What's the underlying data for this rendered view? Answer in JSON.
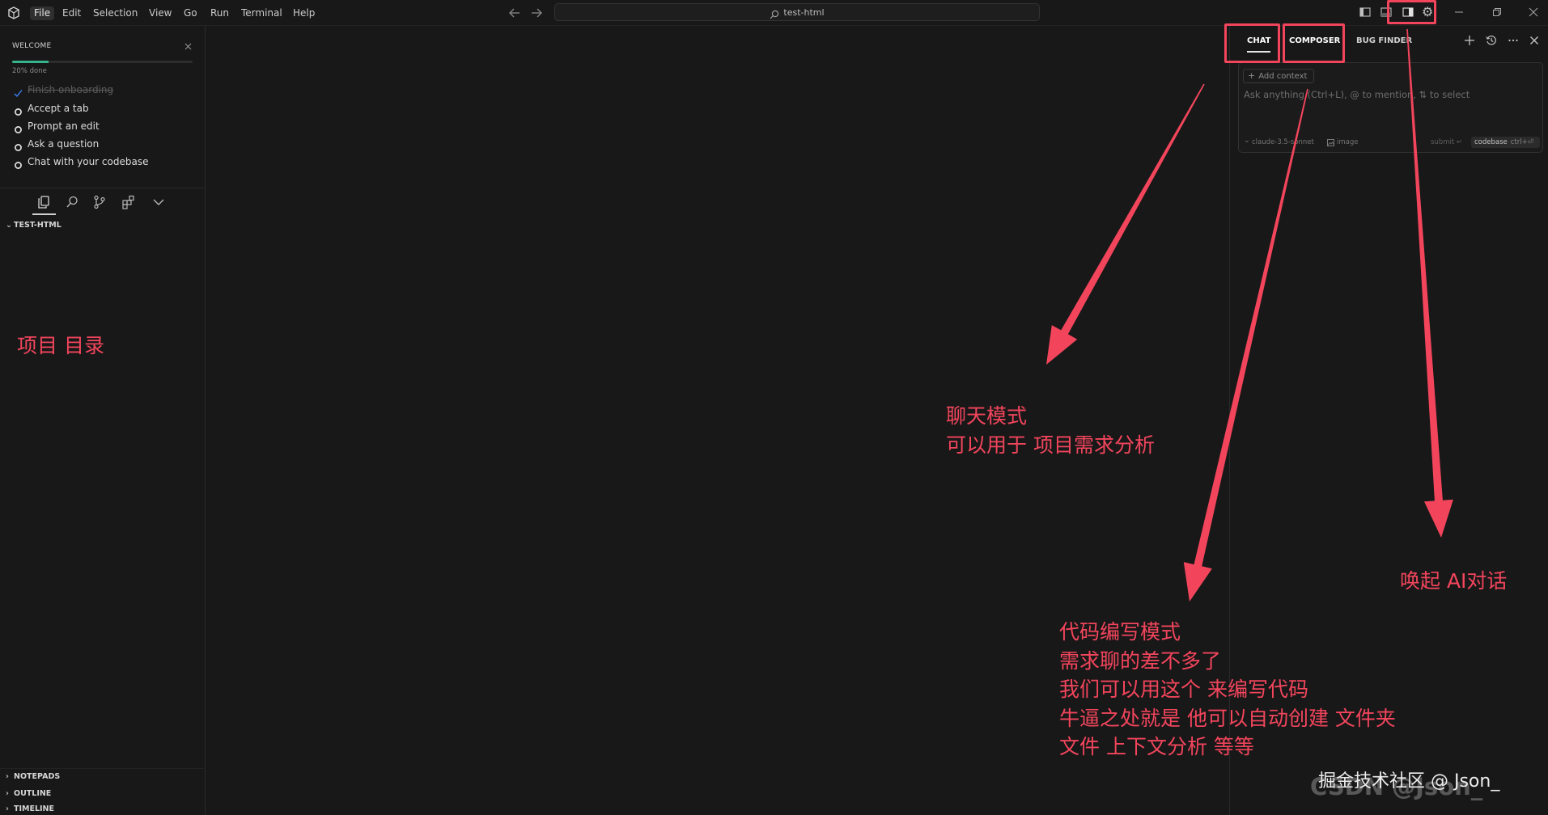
{
  "app": {
    "menu": [
      "File",
      "Edit",
      "Selection",
      "View",
      "Go",
      "Run",
      "Terminal",
      "Help"
    ],
    "search": "test-html"
  },
  "welcome": {
    "title": "WELCOME",
    "progress": 0.2,
    "progress_text": "20% done",
    "items": [
      {
        "label": "Finish onboarding",
        "done": true
      },
      {
        "label": "Accept a tab",
        "done": false
      },
      {
        "label": "Prompt an edit",
        "done": false
      },
      {
        "label": "Ask a question",
        "done": false
      },
      {
        "label": "Chat with your codebase",
        "done": false
      }
    ]
  },
  "explorer": {
    "folder": "TEST-HTML",
    "sections": [
      "NOTEPADS",
      "OUTLINE",
      "TIMELINE"
    ]
  },
  "chat_panel": {
    "tabs": [
      "CHAT",
      "COMPOSER",
      "BUG FINDER"
    ],
    "add_context": "Add context",
    "placeholder": "Ask anything (Ctrl+L), @ to mention, ⇅ to select",
    "model": "claude-3.5-sonnet",
    "image_label": "image",
    "submit_label": "submit ↵",
    "codebase_label": "codebase",
    "codebase_shortcut": "ctrl+⏎"
  },
  "annotations": {
    "project_dir": "项目 目录",
    "chat_mode": [
      "聊天模式",
      "可以用于 项目需求分析"
    ],
    "composer_mode": [
      "代码编写模式",
      "需求聊的差不多了",
      "我们可以用这个 来编写代码",
      "牛逼之处就是 他可以自动创建 文件夹",
      "文件 上下文分析 等等"
    ],
    "ai_dialog": "唤起 AI对话"
  },
  "watermark": {
    "primary": "掘金技术社区 @ Json_",
    "secondary": "CSDN @Json_"
  },
  "colors": {
    "annotation": "#f2455c",
    "progress": "#35b38b",
    "check": "#3b82f6",
    "background": "#181818",
    "border": "#2a2a2a"
  },
  "icons": [
    "logo-icon",
    "back-arrow-icon",
    "forward-arrow-icon",
    "search-icon",
    "panel-left-icon",
    "panel-bottom-icon",
    "panel-right-icon",
    "gear-icon",
    "minimize-icon",
    "restore-icon",
    "close-icon",
    "files-icon",
    "source-control-icon",
    "extensions-icon",
    "chevron-down-icon",
    "chevron-right-icon",
    "check-icon",
    "circle-icon",
    "plus-icon",
    "history-icon",
    "more-icon",
    "image-icon"
  ]
}
